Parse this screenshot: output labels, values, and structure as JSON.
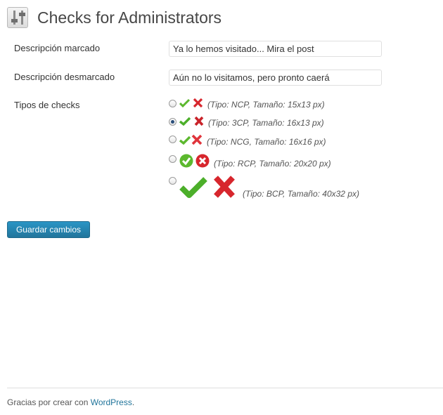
{
  "header": {
    "title": "Checks for Administrators",
    "icon": "settings-sliders-icon"
  },
  "form": {
    "checked_desc": {
      "label": "Descripción marcado",
      "value": "Ya lo hemos visitado... Mira el post"
    },
    "unchecked_desc": {
      "label": "Descripción desmarcado",
      "value": "Aún no lo visitamos, pero pronto caerá"
    },
    "check_types": {
      "label": "Tipos de checks",
      "options": [
        {
          "text": "(Tipo: NCP, Tamaño: 15x13 px)",
          "checked": false
        },
        {
          "text": "(Tipo: 3CP, Tamaño: 16x13 px)",
          "checked": true
        },
        {
          "text": "(Tipo: NCG, Tamaño: 16x16 px)",
          "checked": false
        },
        {
          "text": "(Tipo: RCP, Tamaño: 20x20 px)",
          "checked": false
        },
        {
          "text": "(Tipo: BCP, Tamaño: 40x32 px)",
          "checked": false
        }
      ]
    },
    "save_label": "Guardar cambios"
  },
  "footer": {
    "text": "Gracias por crear con ",
    "link": "WordPress",
    "suffix": "."
  },
  "colors": {
    "accent": "#21759b",
    "check_green": "#5cb82e",
    "cross_red": "#d7262d"
  }
}
